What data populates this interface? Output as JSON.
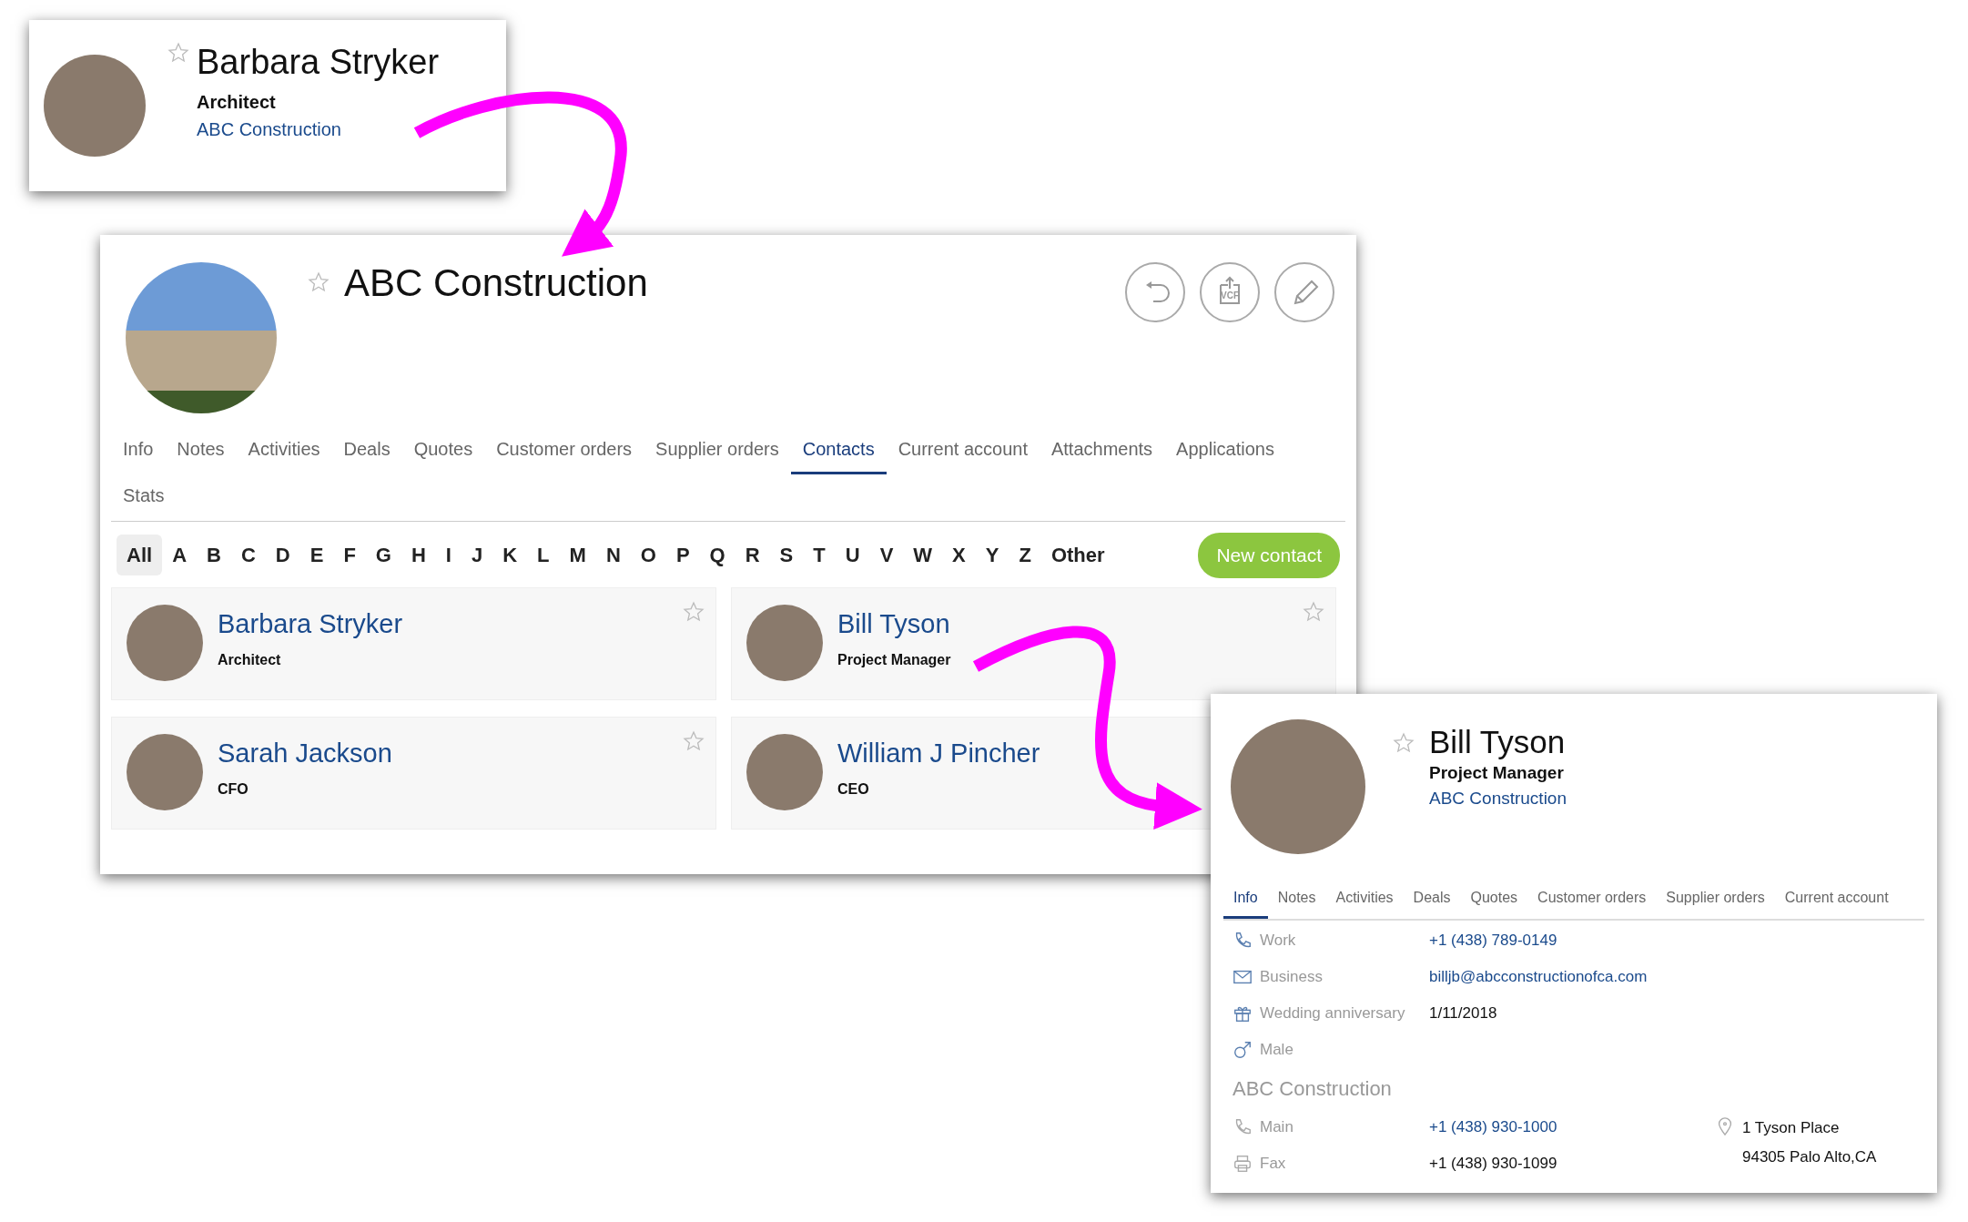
{
  "contact_popup": {
    "name": "Barbara Stryker",
    "starred": false,
    "job_title": "Architect",
    "company": "ABC Construction"
  },
  "company_panel": {
    "name": "ABC Construction",
    "starred": false,
    "action_buttons": [
      {
        "kind": "undo"
      },
      {
        "kind": "vcf",
        "label": "VCF"
      },
      {
        "kind": "edit"
      }
    ],
    "tabs": [
      {
        "label": "Info",
        "selected": false
      },
      {
        "label": "Notes",
        "selected": false
      },
      {
        "label": "Activities",
        "selected": false
      },
      {
        "label": "Deals",
        "selected": false
      },
      {
        "label": "Quotes",
        "selected": false
      },
      {
        "label": "Customer orders",
        "selected": false
      },
      {
        "label": "Supplier orders",
        "selected": false
      },
      {
        "label": "Contacts",
        "selected": true
      },
      {
        "label": "Current account",
        "selected": false
      },
      {
        "label": "Attachments",
        "selected": false
      },
      {
        "label": "Applications",
        "selected": false
      },
      {
        "label": "Stats",
        "selected": false
      }
    ],
    "letters": [
      {
        "label": "All",
        "selected": true
      },
      {
        "label": "A",
        "selected": false
      },
      {
        "label": "B",
        "selected": false
      },
      {
        "label": "C",
        "selected": false
      },
      {
        "label": "D",
        "selected": false
      },
      {
        "label": "E",
        "selected": false
      },
      {
        "label": "F",
        "selected": false
      },
      {
        "label": "G",
        "selected": false
      },
      {
        "label": "H",
        "selected": false
      },
      {
        "label": "I",
        "selected": false
      },
      {
        "label": "J",
        "selected": false
      },
      {
        "label": "K",
        "selected": false
      },
      {
        "label": "L",
        "selected": false
      },
      {
        "label": "M",
        "selected": false
      },
      {
        "label": "N",
        "selected": false
      },
      {
        "label": "O",
        "selected": false
      },
      {
        "label": "P",
        "selected": false
      },
      {
        "label": "Q",
        "selected": false
      },
      {
        "label": "R",
        "selected": false
      },
      {
        "label": "S",
        "selected": false
      },
      {
        "label": "T",
        "selected": false
      },
      {
        "label": "U",
        "selected": false
      },
      {
        "label": "V",
        "selected": false
      },
      {
        "label": "W",
        "selected": false
      },
      {
        "label": "X",
        "selected": false
      },
      {
        "label": "Y",
        "selected": false
      },
      {
        "label": "Z",
        "selected": false
      },
      {
        "label": "Other",
        "selected": false
      }
    ],
    "new_contact_button": "New contact",
    "contacts": [
      {
        "name": "Barbara Stryker",
        "job_title": "Architect",
        "starred": false
      },
      {
        "name": "Bill Tyson",
        "job_title": "Project Manager",
        "starred": false
      },
      {
        "name": "Sarah Jackson",
        "job_title": "CFO",
        "starred": false
      },
      {
        "name": "William J Pincher",
        "job_title": "CEO"
      }
    ]
  },
  "contact_detail": {
    "name": "Bill Tyson",
    "starred": false,
    "job_title": "Project Manager",
    "company": "ABC Construction",
    "tabs": [
      {
        "label": "Info",
        "selected": true
      },
      {
        "label": "Notes",
        "selected": false
      },
      {
        "label": "Activities",
        "selected": false
      },
      {
        "label": "Deals",
        "selected": false
      },
      {
        "label": "Quotes",
        "selected": false
      },
      {
        "label": "Customer orders",
        "selected": false
      },
      {
        "label": "Supplier orders",
        "selected": false
      },
      {
        "label": "Current account",
        "selected": false
      }
    ],
    "fields": [
      {
        "kind": "phone",
        "label": "Work",
        "value": "+1 (438) 789-0149",
        "link": true
      },
      {
        "kind": "email",
        "label": "Business",
        "value": "billjb@abcconstructionofca.com",
        "link": true
      },
      {
        "kind": "gift",
        "label": "Wedding anniversary",
        "value": "1/11/2018",
        "link": false
      },
      {
        "kind": "gender",
        "label": "Male"
      }
    ],
    "company_section": {
      "title": "ABC Construction",
      "fields": [
        {
          "kind": "phone",
          "label": "Main",
          "value": "+1 (438) 930-1000",
          "link": true
        },
        {
          "kind": "fax",
          "label": "Fax",
          "value": "+1 (438) 930-1099",
          "link": false
        }
      ],
      "address_lines": [
        "1 Tyson Place",
        "94305 Palo Alto,CA"
      ]
    }
  }
}
